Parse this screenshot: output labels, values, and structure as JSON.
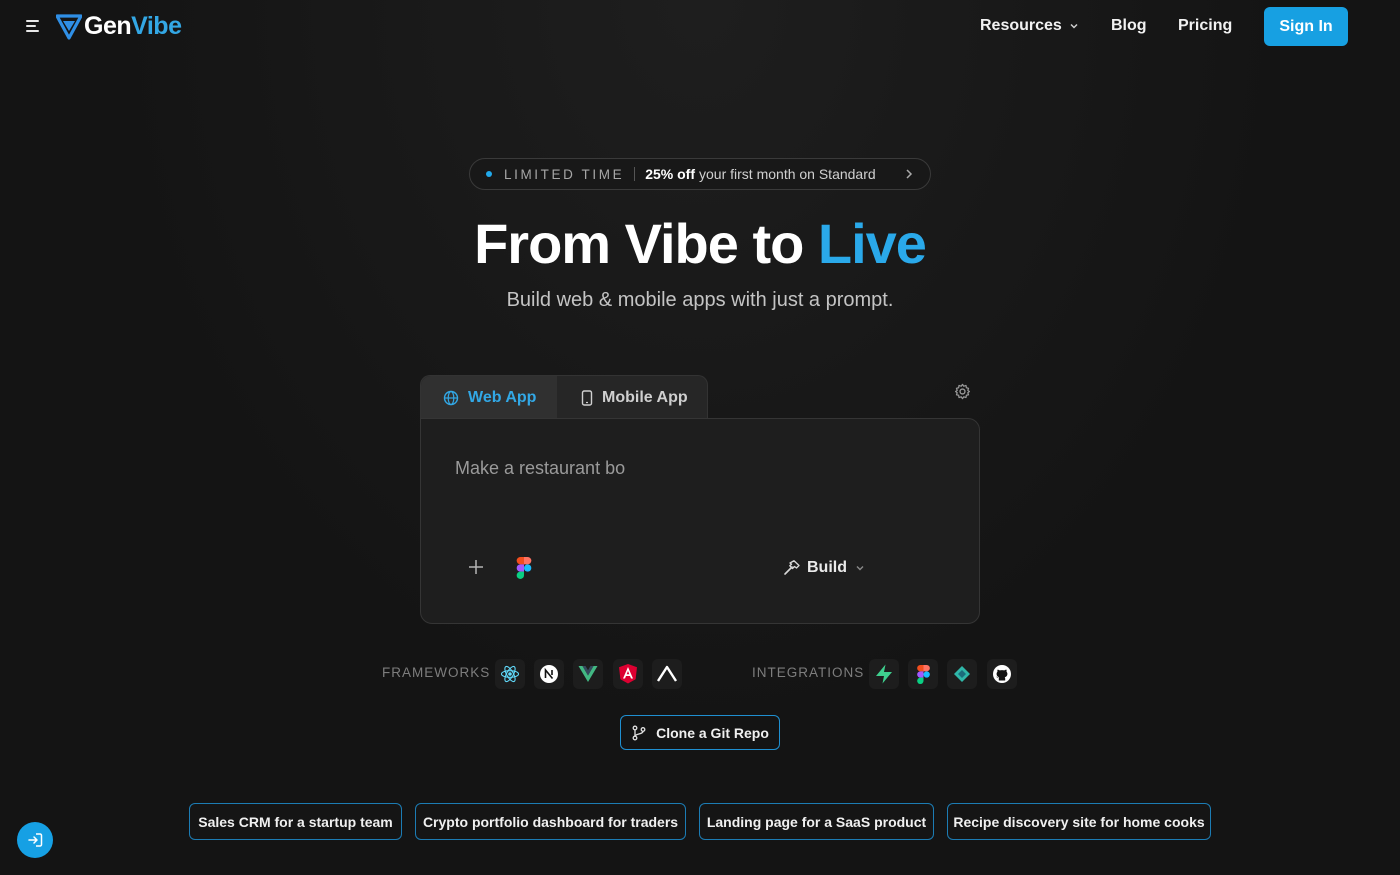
{
  "header": {
    "logo_gen": "Gen",
    "logo_vibe": "Vibe",
    "nav": {
      "resources": "Resources",
      "blog": "Blog",
      "pricing": "Pricing"
    },
    "sign_in": "Sign In"
  },
  "promo": {
    "tag": "LIMITED TIME",
    "highlight": "25% off",
    "text": "your first month on Standard"
  },
  "hero": {
    "headline_main": "From Vibe to ",
    "headline_accent": "Live",
    "subhead": "Build web & mobile apps with just a prompt."
  },
  "tabs": [
    {
      "label": "Web App",
      "active": true
    },
    {
      "label": "Mobile App",
      "active": false
    }
  ],
  "prompt": {
    "value": "Make a restaurant bo",
    "build_label": "Build"
  },
  "frameworks": {
    "label": "FRAMEWORKS",
    "icons": [
      "react-icon",
      "nextjs-icon",
      "vue-icon",
      "angular-icon",
      "nuxt-icon"
    ]
  },
  "integrations": {
    "label": "INTEGRATIONS",
    "icons": [
      "supabase-icon",
      "figma-icon",
      "stripe-icon",
      "github-icon"
    ]
  },
  "clone_label": "Clone a Git Repo",
  "suggestions": [
    "Sales CRM for a startup team",
    "Crypto portfolio dashboard for traders",
    "Landing page for a SaaS product",
    "Recipe discovery site for home cooks"
  ],
  "colors": {
    "accent": "#17a0e2",
    "background": "#141414",
    "panel": "#1e1e1e"
  }
}
